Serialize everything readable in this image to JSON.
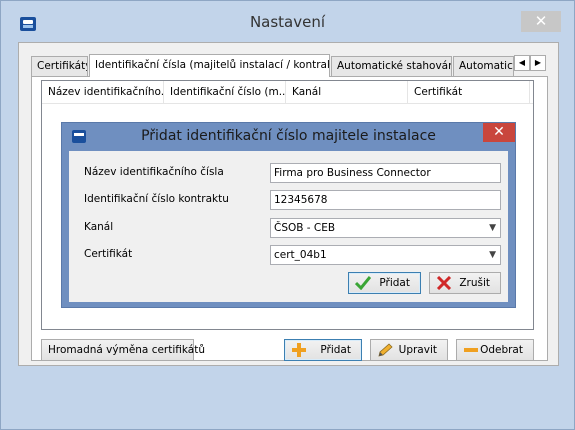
{
  "window": {
    "title": "Nastavení",
    "close_glyph": "✕",
    "app_icon": "csob-logo-icon"
  },
  "tabs": [
    {
      "label": "Certifikáty",
      "active": false
    },
    {
      "label": "Identifikační čísla (majitelů instalací / kontraktů)",
      "active": true
    },
    {
      "label": "Automatické stahování",
      "active": false
    },
    {
      "label": "Automatické",
      "active": false
    }
  ],
  "tab_scroll": {
    "left": "◀",
    "right": "▶"
  },
  "list": {
    "columns": [
      "Název identifikačního...",
      "Identifikační číslo (m...",
      "Kanál",
      "Certifikát"
    ]
  },
  "buttons": {
    "bulk_replace": "Hromadná výměna certifikátů",
    "add": "Přidat",
    "edit": "Upravit",
    "remove": "Odebrat"
  },
  "dialog": {
    "title": "Přidat identifikační číslo majitele instalace",
    "close_glyph": "✕",
    "fields": {
      "name_label": "Název identifikačního čísla",
      "name_value": "Firma pro Business Connector",
      "contract_label": "Identifikační číslo kontraktu",
      "contract_value": "12345678",
      "channel_label": "Kanál",
      "channel_value": "ČSOB - CEB",
      "certificate_label": "Certifikát",
      "certificate_value": "cert_04b1"
    },
    "buttons": {
      "ok": "Přidat",
      "cancel": "Zrušit"
    }
  },
  "colors": {
    "window_bg": "#c2d4ea",
    "dialog_frame": "#6f8fc0",
    "dialog_close": "#c9463d",
    "add_icon": "#f0a020",
    "check_icon": "#3aa535",
    "cross_icon": "#d02828"
  }
}
